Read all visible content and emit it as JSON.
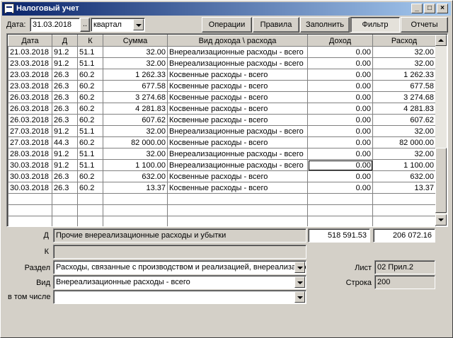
{
  "window": {
    "title": "Налоговый учет"
  },
  "toolbar": {
    "date_label": "Дата:",
    "date_value": "31.03.2018",
    "ellipsis": "..",
    "period_value": "квартал",
    "buttons": [
      "Операции",
      "Правила",
      "Заполнить",
      "Фильтр",
      "Отчеты"
    ],
    "active_button": "Фильтр"
  },
  "grid": {
    "headers": [
      "Дата",
      "Д",
      "К",
      "Сумма",
      "Вид дохода \\ расхода",
      "Доход",
      "Расход"
    ],
    "rows": [
      [
        "21.03.2018",
        "91.2",
        "51.1",
        "32.00",
        "Внереализационные расходы - всего",
        "0.00",
        "32.00"
      ],
      [
        "23.03.2018",
        "91.2",
        "51.1",
        "32.00",
        "Внереализационные расходы - всего",
        "0.00",
        "32.00"
      ],
      [
        "23.03.2018",
        "26.3",
        "60.2",
        "1 262.33",
        "Косвенные расходы - всего",
        "0.00",
        "1 262.33"
      ],
      [
        "23.03.2018",
        "26.3",
        "60.2",
        "677.58",
        "Косвенные расходы - всего",
        "0.00",
        "677.58"
      ],
      [
        "26.03.2018",
        "26.3",
        "60.2",
        "3 274.68",
        "Косвенные расходы - всего",
        "0.00",
        "3 274.68"
      ],
      [
        "26.03.2018",
        "26.3",
        "60.2",
        "4 281.83",
        "Косвенные расходы - всего",
        "0.00",
        "4 281.83"
      ],
      [
        "26.03.2018",
        "26.3",
        "60.2",
        "607.62",
        "Косвенные расходы - всего",
        "0.00",
        "607.62"
      ],
      [
        "27.03.2018",
        "91.2",
        "51.1",
        "32.00",
        "Внереализационные расходы - всего",
        "0.00",
        "32.00"
      ],
      [
        "27.03.2018",
        "44.3",
        "60.2",
        "82 000.00",
        "Косвенные расходы - всего",
        "0.00",
        "82 000.00"
      ],
      [
        "28.03.2018",
        "91.2",
        "51.1",
        "32.00",
        "Внереализационные расходы - всего",
        "0.00",
        "32.00"
      ],
      [
        "30.03.2018",
        "91.2",
        "51.1",
        "1 100.00",
        "Внереализационные расходы - всего",
        "0.00",
        "1 100.00"
      ],
      [
        "30.03.2018",
        "26.3",
        "60.2",
        "632.00",
        "Косвенные расходы - всего",
        "0.00",
        "632.00"
      ],
      [
        "30.03.2018",
        "26.3",
        "60.2",
        "13.37",
        "Косвенные расходы - всего",
        "0.00",
        "13.37"
      ]
    ],
    "empty_rows": 3
  },
  "details": {
    "d_label": "Д",
    "d_value": "Прочие внереализационные расходы и убытки",
    "income_total": "518 591.53",
    "expense_total": "206 072.16",
    "k_label": "К",
    "k_value": "",
    "razdel_label": "Раздел",
    "razdel_value": "Расходы, связанные с производством и реализацией, внереализационные",
    "vid_label": "Вид",
    "vid_value": "Внереализационные расходы - всего",
    "vtom_label": "в том числе",
    "vtom_value": "",
    "list_label": "Лист",
    "list_value": "02 Прил.2",
    "stroka_label": "Строка",
    "stroka_value": "200"
  }
}
